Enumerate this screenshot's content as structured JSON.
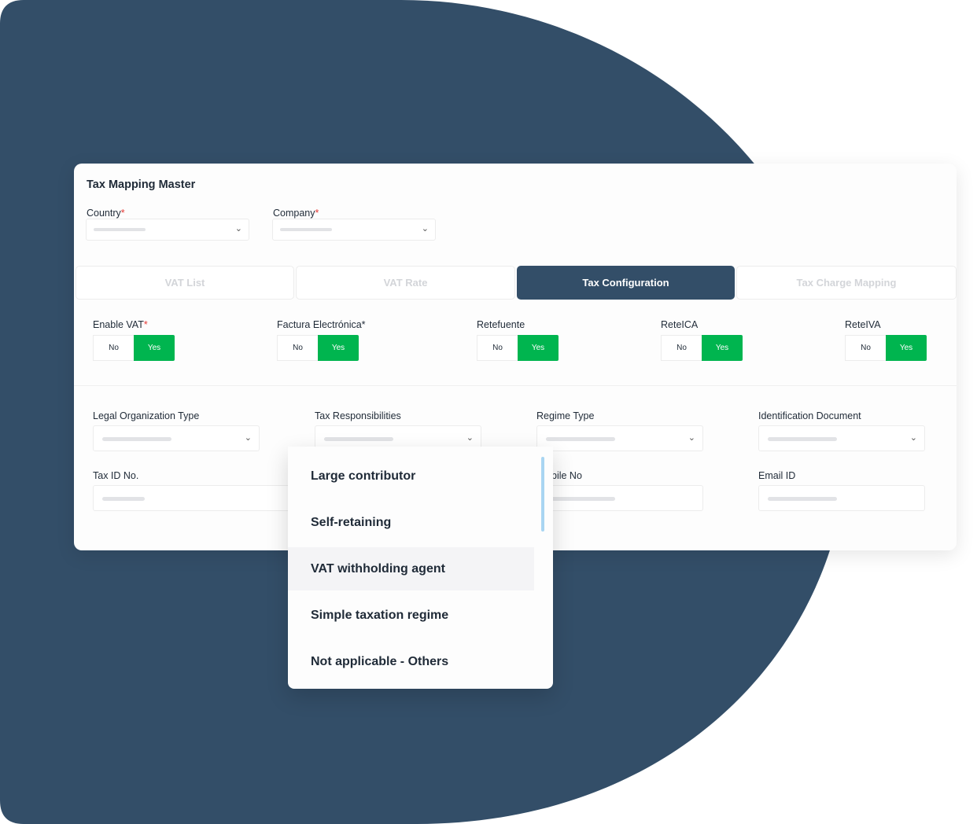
{
  "panel": {
    "title": "Tax Mapping Master"
  },
  "filters": {
    "country_label": "Country",
    "company_label": "Company",
    "required_mark": "*"
  },
  "tabs": [
    {
      "label": "VAT List",
      "active": false
    },
    {
      "label": "VAT Rate",
      "active": false
    },
    {
      "label": "Tax Configuration",
      "active": true
    },
    {
      "label": "Tax Charge Mapping",
      "active": false
    }
  ],
  "toggles": [
    {
      "label": "Enable VAT",
      "required": "*",
      "no": "No",
      "yes": "Yes",
      "selected": "Yes"
    },
    {
      "label": "Factura Electrónica*",
      "no": "No",
      "yes": "Yes",
      "selected": "Yes"
    },
    {
      "label": "Retefuente",
      "no": "No",
      "yes": "Yes",
      "selected": "Yes"
    },
    {
      "label": "ReteICA",
      "no": "No",
      "yes": "Yes",
      "selected": "Yes"
    },
    {
      "label": "ReteIVA",
      "no": "No",
      "yes": "Yes",
      "selected": "Yes"
    }
  ],
  "form": {
    "legal_org_type": "Legal Organization Type",
    "tax_responsibilities": "Tax Responsibilities",
    "regime_type": "Regime Type",
    "identification_document": "Identification Document",
    "tax_id": "Tax ID No.",
    "mobile_no_partial": "bile No",
    "email_id": "Email ID"
  },
  "dropdown": {
    "options": [
      "Large contributor",
      "Self-retaining",
      "VAT withholding agent",
      "Simple taxation regime",
      "Not applicable - Others"
    ],
    "highlighted": "VAT withholding agent"
  },
  "colors": {
    "brand_navy": "#334e68",
    "yes_green": "#00b54f",
    "required_red": "#e53935",
    "scrollbar": "#a9d5f2"
  }
}
